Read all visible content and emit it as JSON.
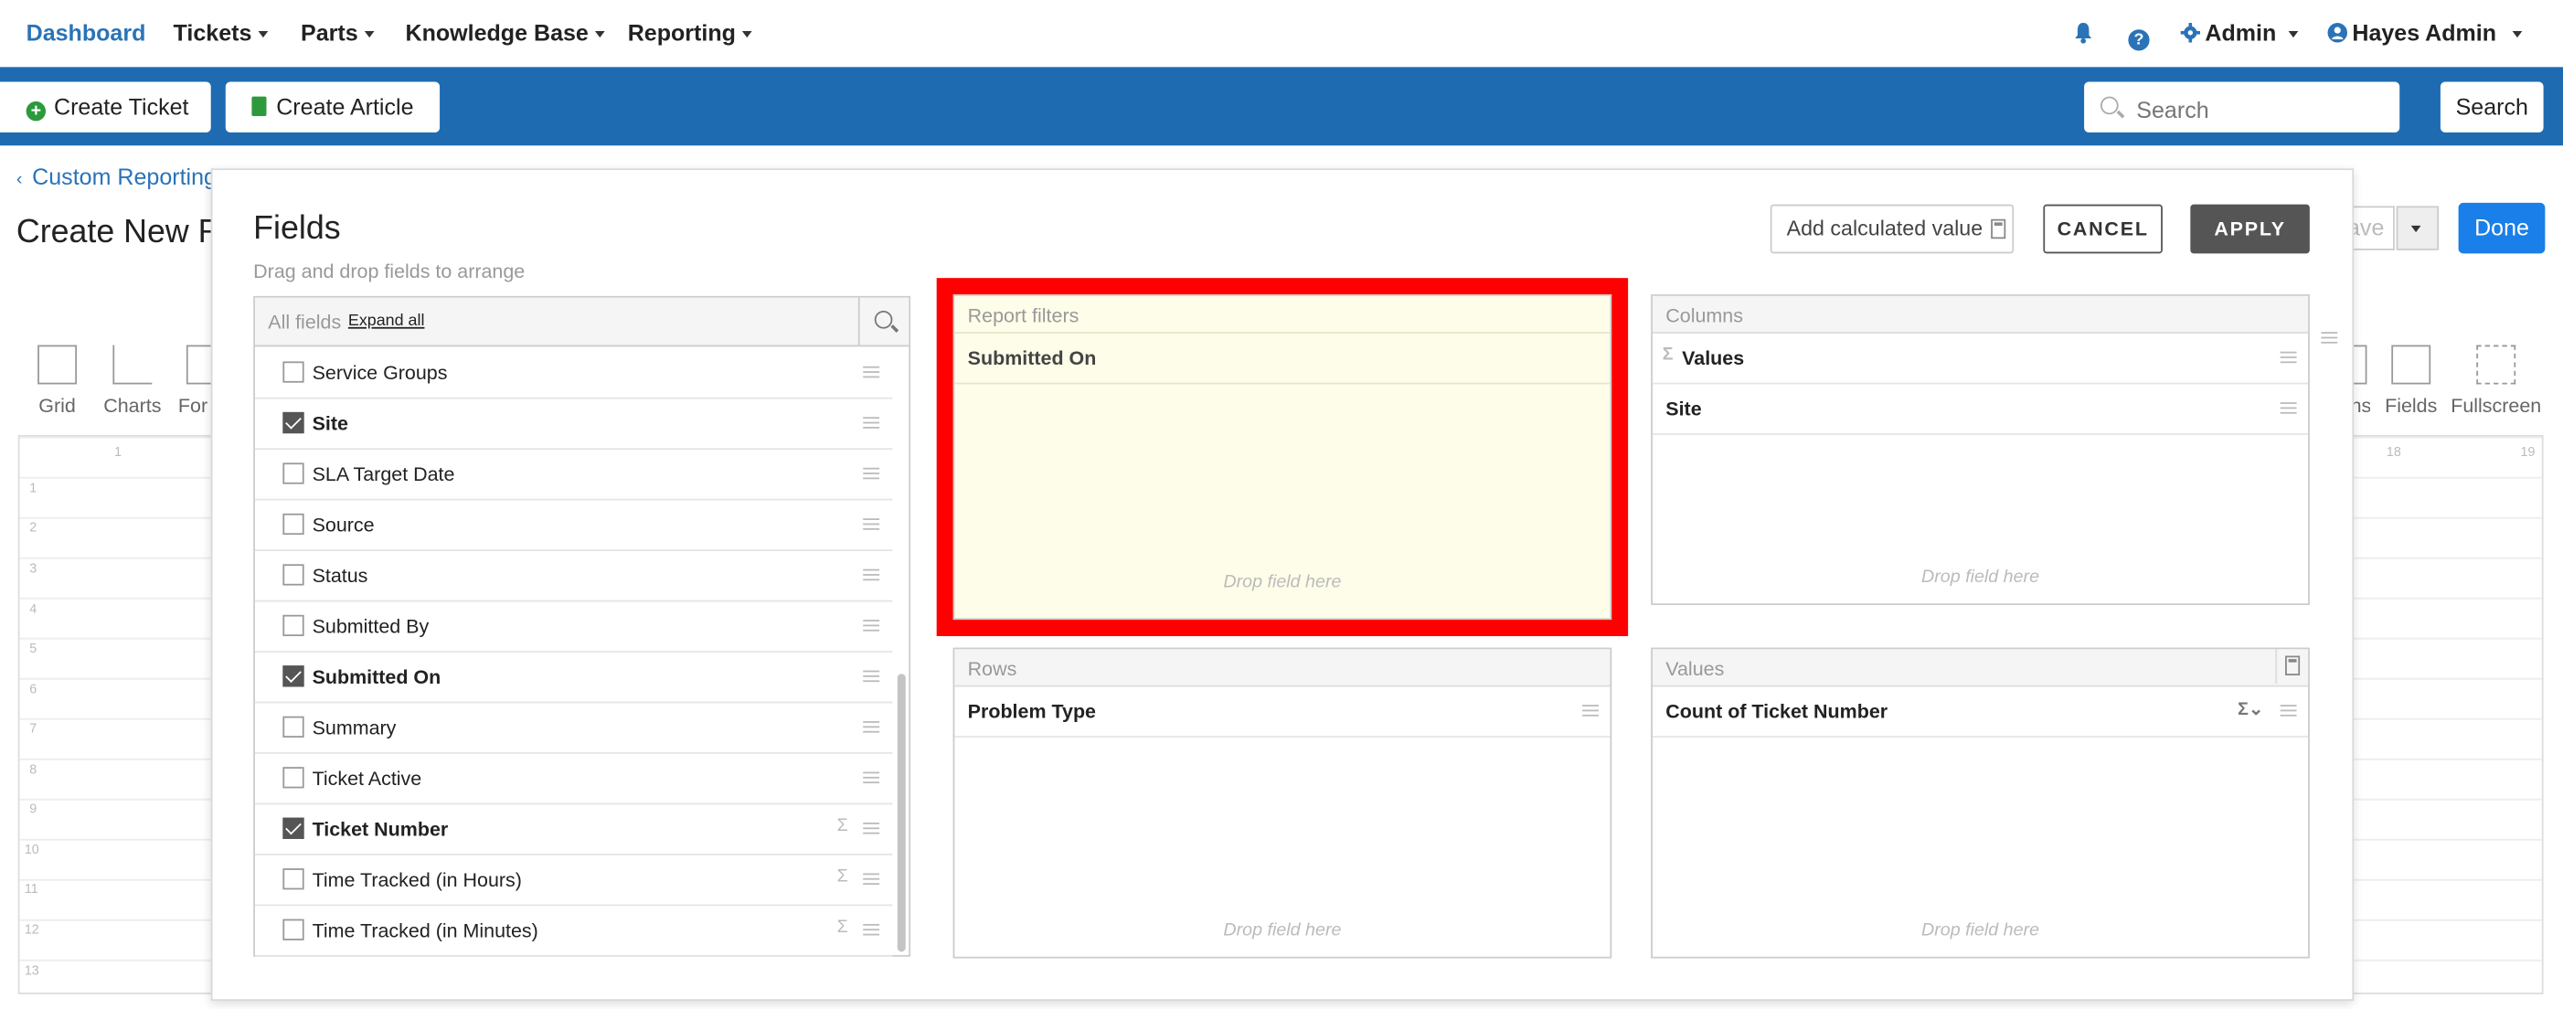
{
  "nav": {
    "dashboard": "Dashboard",
    "tickets": "Tickets",
    "parts": "Parts",
    "knowledge_base": "Knowledge Base",
    "reporting": "Reporting",
    "admin": "Admin",
    "user": "Hayes Admin",
    "accent": "#2a73b8"
  },
  "toolbar": {
    "create_ticket": "Create Ticket",
    "create_article": "Create Article",
    "search_placeholder": "Search",
    "search_button": "Search",
    "bar_color": "#1f6bb1"
  },
  "page": {
    "back_link": "Custom Reporting",
    "title": "Create New R",
    "save_label": "ave",
    "done_label": "Done",
    "tools_left": [
      "Grid",
      "Charts",
      "For"
    ],
    "tools_right": [
      "ns",
      "Fields",
      "Fullscreen"
    ],
    "row_numbers": [
      "1",
      "2",
      "3",
      "4",
      "5",
      "6",
      "7",
      "8",
      "9",
      "10",
      "11",
      "12",
      "13"
    ],
    "col_numbers": [
      "1",
      "18",
      "19"
    ]
  },
  "modal": {
    "title": "Fields",
    "subtitle": "Drag and drop fields to arrange",
    "add_calculated": "Add calculated value",
    "cancel": "CANCEL",
    "apply": "APPLY",
    "all_fields_label": "All fields",
    "expand_all": "Expand all",
    "fields": [
      {
        "name": "Service Groups",
        "checked": false,
        "sigma": false
      },
      {
        "name": "Site",
        "checked": true,
        "sigma": false
      },
      {
        "name": "SLA Target Date",
        "checked": false,
        "sigma": false
      },
      {
        "name": "Source",
        "checked": false,
        "sigma": false
      },
      {
        "name": "Status",
        "checked": false,
        "sigma": false
      },
      {
        "name": "Submitted By",
        "checked": false,
        "sigma": false
      },
      {
        "name": "Submitted On",
        "checked": true,
        "sigma": false
      },
      {
        "name": "Summary",
        "checked": false,
        "sigma": false
      },
      {
        "name": "Ticket Active",
        "checked": false,
        "sigma": false
      },
      {
        "name": "Ticket Number",
        "checked": true,
        "sigma": true
      },
      {
        "name": "Time Tracked (in Hours)",
        "checked": false,
        "sigma": true
      },
      {
        "name": "Time Tracked (in Minutes)",
        "checked": false,
        "sigma": true
      }
    ],
    "report_filters": {
      "label": "Report filters",
      "items": [
        "Submitted On"
      ],
      "drop": "Drop field here"
    },
    "columns": {
      "label": "Columns",
      "items": [
        "Values",
        "Site"
      ],
      "drop": "Drop field here"
    },
    "rows": {
      "label": "Rows",
      "items": [
        "Problem Type"
      ],
      "drop": "Drop field here"
    },
    "values": {
      "label": "Values",
      "items": [
        "Count of Ticket Number"
      ],
      "drop": "Drop field here"
    },
    "highlight_color": "#ff0000"
  }
}
